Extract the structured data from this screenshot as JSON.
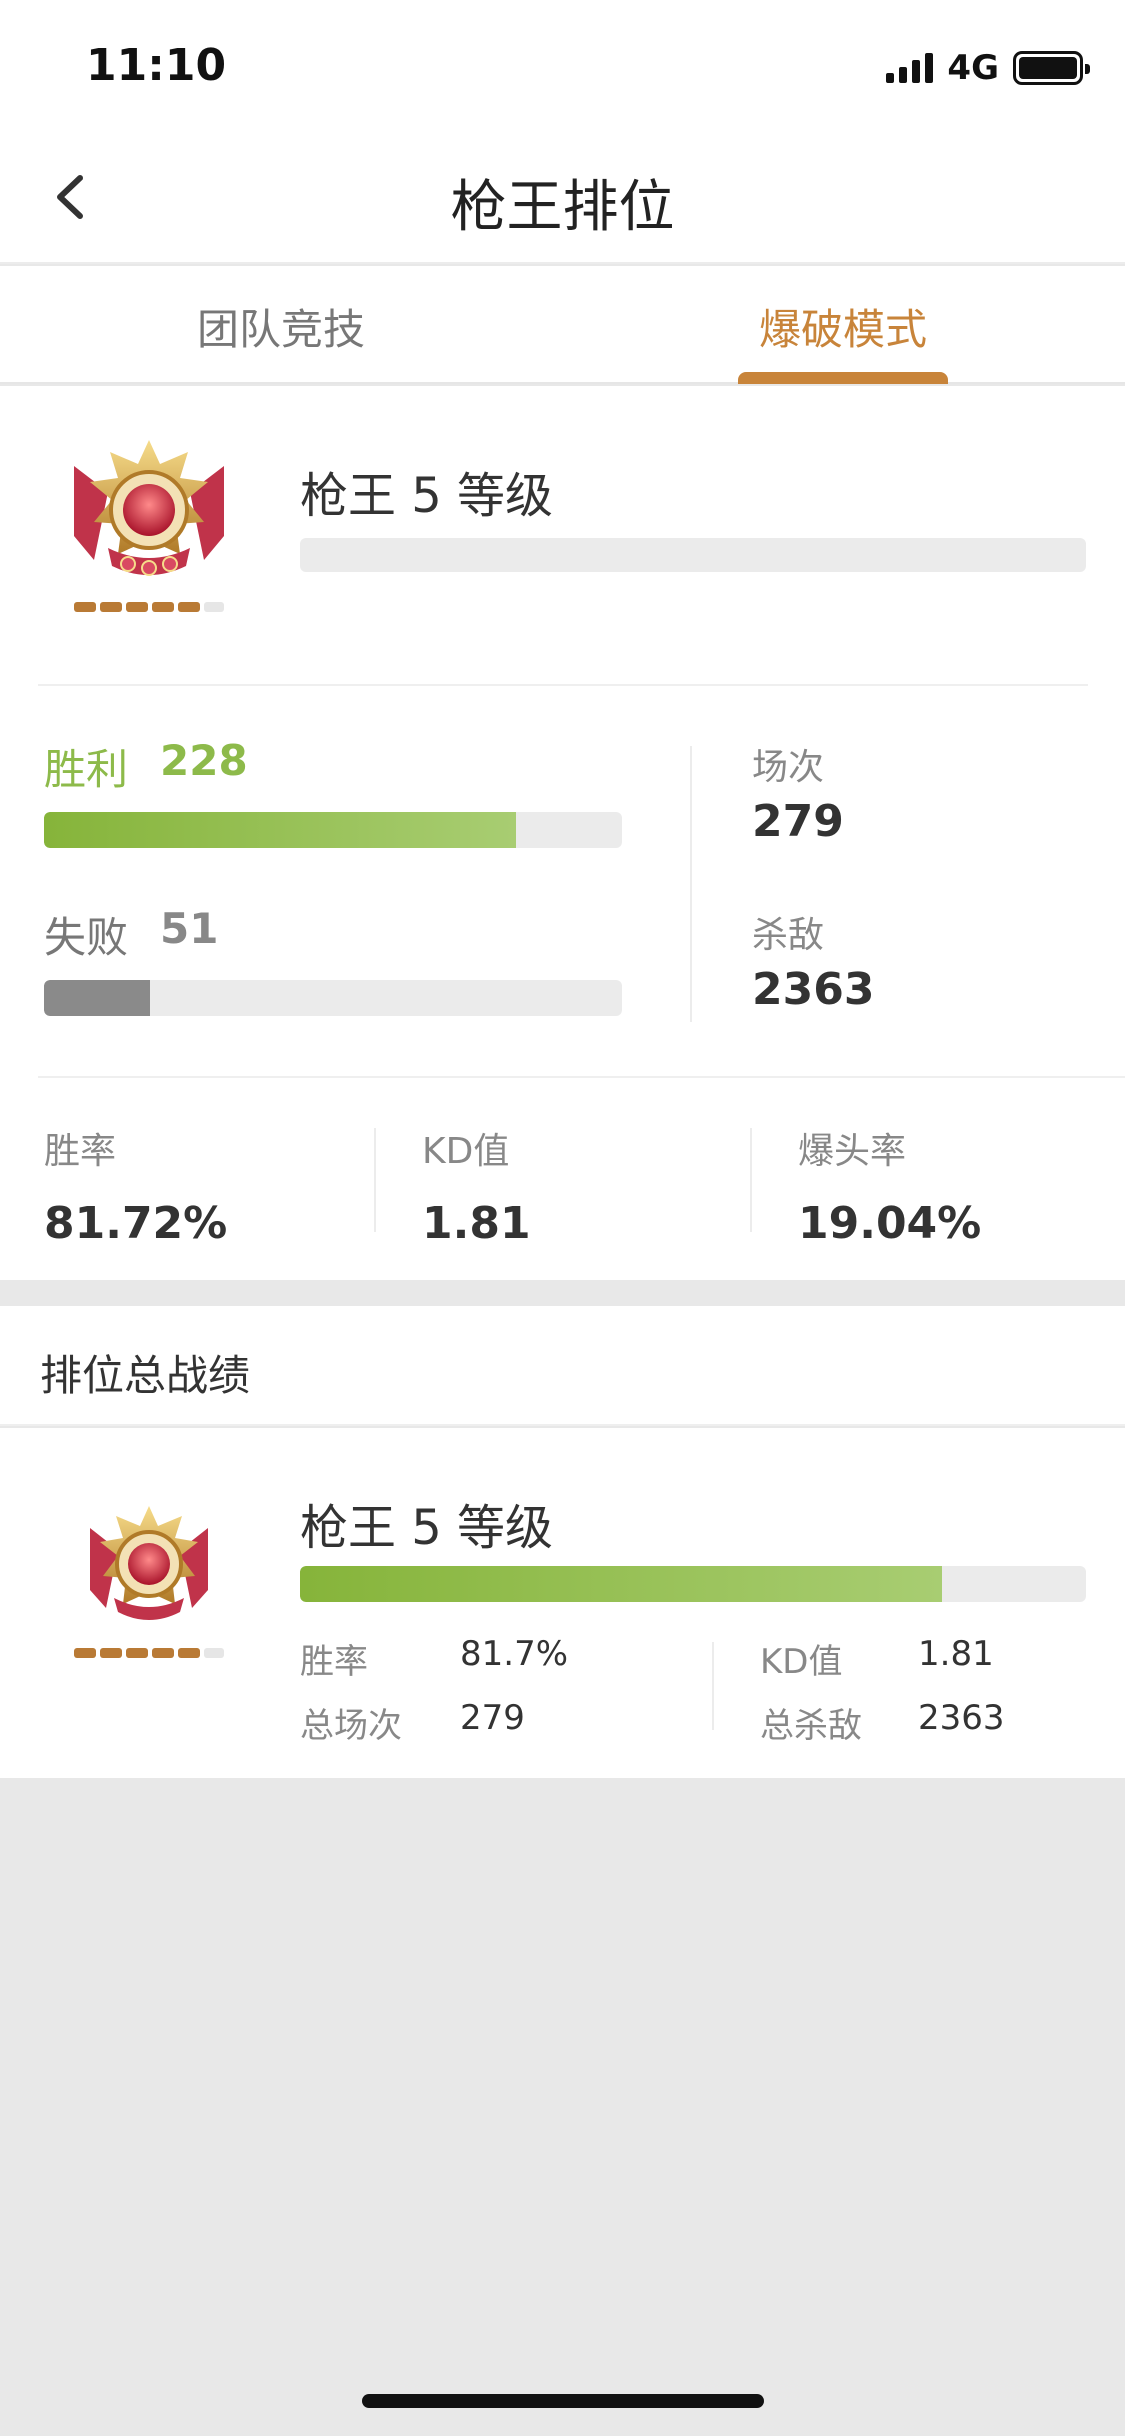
{
  "status_bar": {
    "time": "11:10",
    "network": "4G"
  },
  "nav": {
    "title": "枪王排位"
  },
  "tabs": [
    {
      "label": "团队竞技",
      "active": false
    },
    {
      "label": "爆破模式",
      "active": true
    }
  ],
  "rank": {
    "title": "枪王 5 等级",
    "progress_fraction": 0.0
  },
  "results": {
    "win_label": "胜利",
    "win_value": "228",
    "win_fraction": 0.8172,
    "loss_label": "失败",
    "loss_value": "51",
    "loss_fraction": 0.1828,
    "matches_label": "场次",
    "matches_value": "279",
    "kills_label": "杀敌",
    "kills_value": "2363"
  },
  "metrics": {
    "win_rate_label": "胜率",
    "win_rate_value": "81.72%",
    "kd_label": "KD值",
    "kd_value": "1.81",
    "headshot_label": "爆头率",
    "headshot_value": "19.04%"
  },
  "overall": {
    "section_title": "排位总战绩",
    "rank_title": "枪王 5 等级",
    "progress_fraction": 0.817,
    "win_rate_label": "胜率",
    "win_rate_value": "81.7%",
    "kd_label": "KD值",
    "kd_value": "1.81",
    "total_matches_label": "总场次",
    "total_matches_value": "279",
    "total_kills_label": "总杀敌",
    "total_kills_value": "2363"
  },
  "colors": {
    "accent": "#c8843a",
    "win_green": "#8dba4a",
    "loss_gray": "#8a8a8a"
  },
  "icons": {
    "back": "chevron-left-icon",
    "rank_badge": "rank-badge-icon"
  }
}
